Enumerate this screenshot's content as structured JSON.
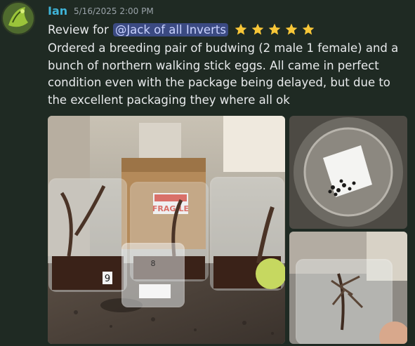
{
  "message": {
    "author": "Ian",
    "timestamp": "5/16/2025 2:00 PM",
    "review_prefix": "Review for",
    "mention": "@Jack of all Inverts",
    "rating": 5,
    "body": "Ordered a breeding pair of budwing (2 male 1 female) and a bunch of northern walking stick eggs. All came in perfect condition even with the package being delayed, but due to the excellent packaging they where all ok"
  },
  "attachments": [
    {
      "type": "image",
      "label": "containers-photo"
    },
    {
      "type": "image",
      "label": "eggs-photo"
    },
    {
      "type": "image",
      "label": "mantis-cup-photo"
    }
  ],
  "photo_text": {
    "box_label": "FRAGILE",
    "cup_label_1": "9",
    "cup_label_2": "8"
  },
  "colors": {
    "background": "#1f2a23",
    "author": "#3fb4d8",
    "mention_bg": "#3b4a82",
    "star": "#f7c638"
  }
}
